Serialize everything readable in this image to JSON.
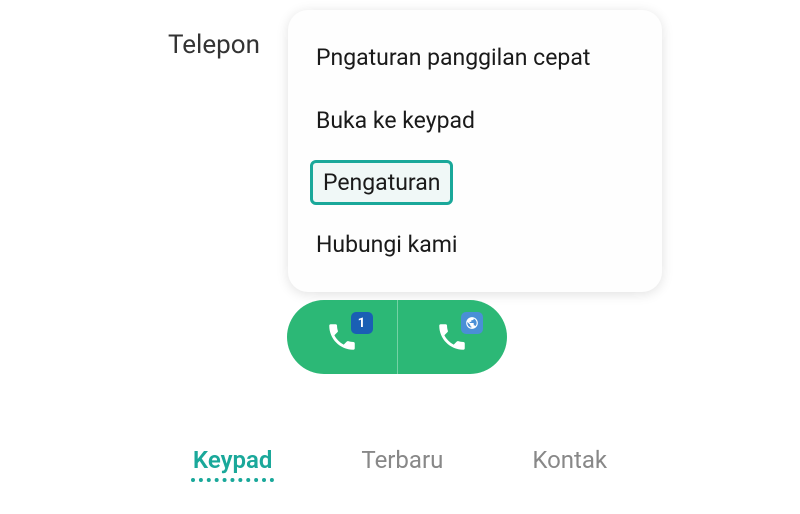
{
  "header": {
    "title": "Telepon"
  },
  "menu": {
    "items": [
      {
        "label": "Pngaturan panggilan cepat",
        "highlighted": false
      },
      {
        "label": "Buka ke keypad",
        "highlighted": false
      },
      {
        "label": "Pengaturan",
        "highlighted": true
      },
      {
        "label": "Hubungi kami",
        "highlighted": false
      }
    ]
  },
  "call_buttons": {
    "sim1_badge": "1",
    "sim2_badge": "globe"
  },
  "tabs": {
    "items": [
      {
        "label": "Keypad",
        "active": true
      },
      {
        "label": "Terbaru",
        "active": false
      },
      {
        "label": "Kontak",
        "active": false
      }
    ]
  },
  "colors": {
    "accent": "#1aa89a",
    "call_green": "#2cb876"
  }
}
